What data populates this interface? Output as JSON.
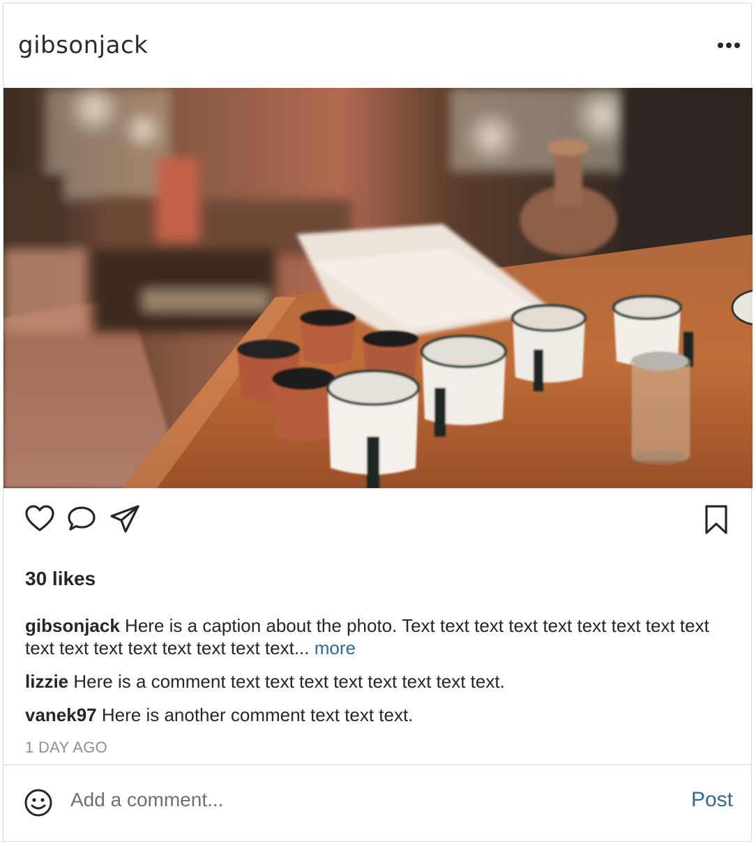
{
  "post": {
    "username": "gibsonjack",
    "photo_alt": "photo",
    "likes": "30 likes",
    "caption": {
      "username": "gibsonjack",
      "text": " Here is a caption about the photo. Text text text text text text text text text text text text text text text text text... ",
      "more_label": "more"
    },
    "comments": [
      {
        "username": "lizzie",
        "text": " Here is a comment text text text text text text text text."
      },
      {
        "username": "vanek97",
        "text": " Here is another comment text text text."
      }
    ],
    "timestamp": "1 DAY AGO"
  },
  "comment_bar": {
    "placeholder": "Add a comment...",
    "post_label": "Post"
  },
  "icons": {
    "menu": "more-horizontal-icon",
    "like": "heart-icon",
    "comment": "comment-bubble-icon",
    "share": "paper-plane-icon",
    "save": "bookmark-icon",
    "emoji": "smiley-icon"
  },
  "colors": {
    "link": "#2e6a96",
    "border": "#dbdbdb",
    "muted": "#8e8e8e"
  }
}
